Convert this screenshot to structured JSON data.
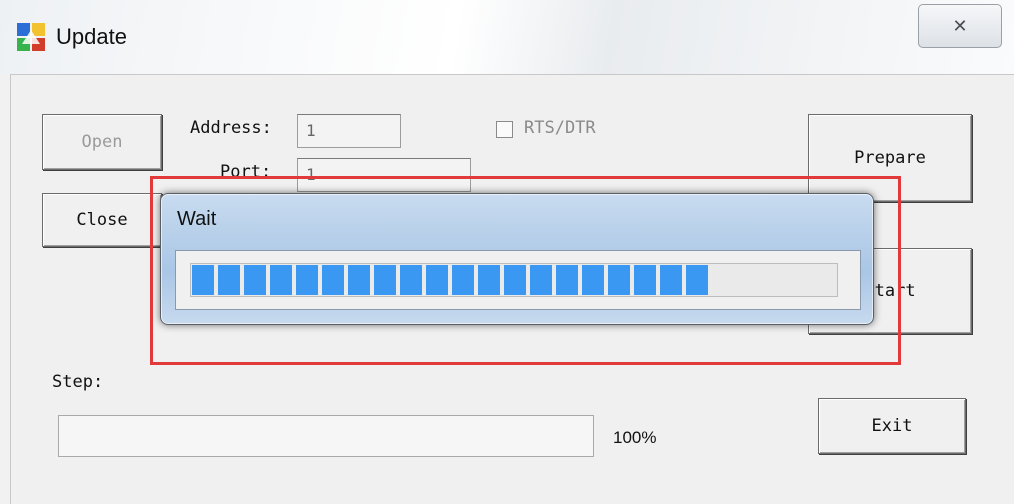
{
  "window": {
    "title": "Update",
    "close_symbol": "✕"
  },
  "buttons": {
    "open": "Open",
    "close": "Close",
    "prepare": "Prepare",
    "start": "Start",
    "exit": "Exit"
  },
  "form": {
    "address_label": "Address:",
    "address_value": "1",
    "port_label": "Port:",
    "port_value": "1",
    "rts_dtr_label": "RTS/DTR",
    "step_label": "Step:"
  },
  "progress": {
    "percent_text": "100%",
    "fraction": 0
  },
  "wait_dialog": {
    "title": "Wait",
    "progress_fraction": 0.8
  },
  "colors": {
    "highlight": "#e23a3a",
    "progress_fill": "#3a97f2"
  },
  "icons": {
    "app": "update-app-icon",
    "close": "close-icon"
  }
}
